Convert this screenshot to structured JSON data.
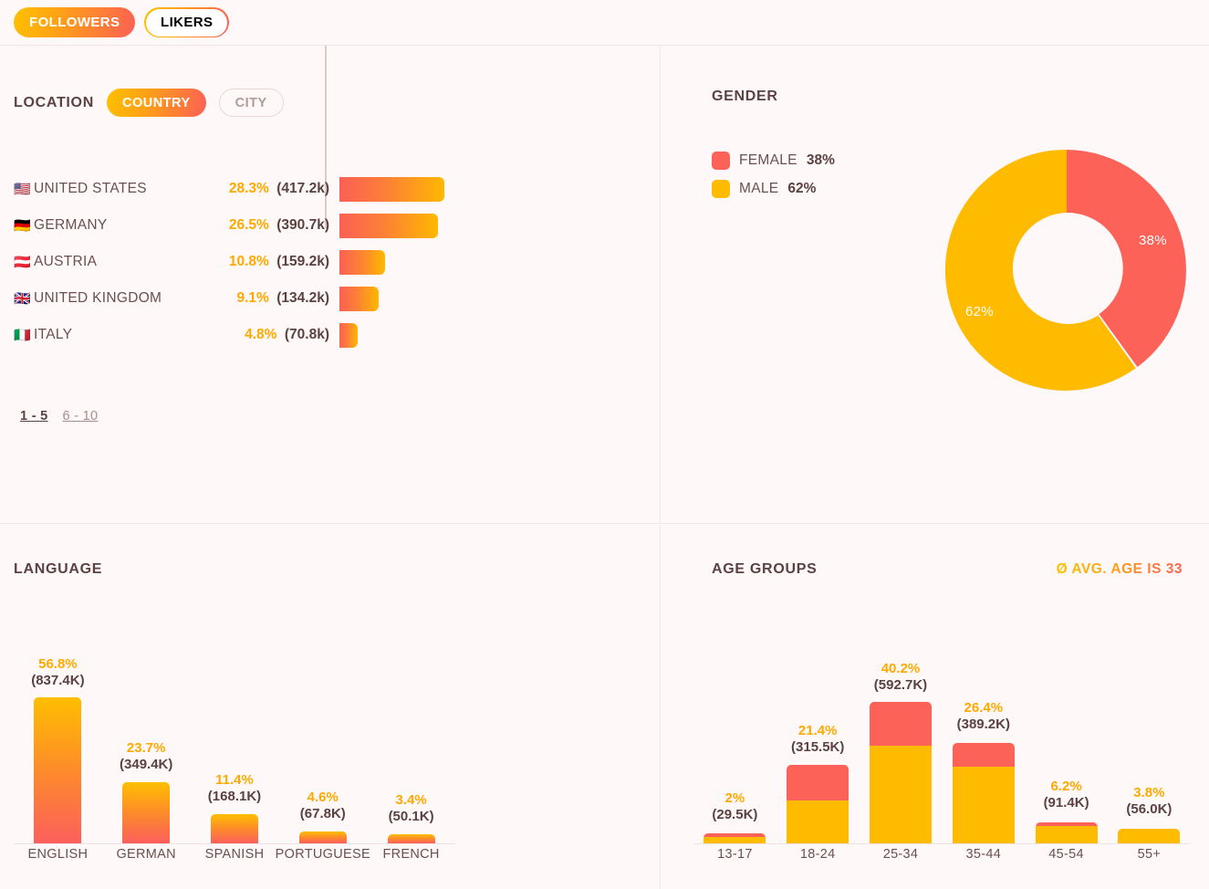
{
  "tabs": [
    {
      "label": "FOLLOWERS",
      "active": true
    },
    {
      "label": "LIKERS",
      "active": false
    }
  ],
  "location": {
    "title": "LOCATION",
    "toggles": [
      {
        "label": "COUNTRY",
        "active": true
      },
      {
        "label": "CITY",
        "active": false
      }
    ],
    "rows": [
      {
        "flag": "🇺🇸",
        "name": "UNITED STATES",
        "pct": "28.3%",
        "count": "(417.2k)",
        "value": 28.3
      },
      {
        "flag": "🇩🇪",
        "name": "GERMANY",
        "pct": "26.5%",
        "count": "(390.7k)",
        "value": 26.5
      },
      {
        "flag": "🇦🇹",
        "name": "AUSTRIA",
        "pct": "10.8%",
        "count": "(159.2k)",
        "value": 10.8
      },
      {
        "flag": "🇬🇧",
        "name": "UNITED KINGDOM",
        "pct": "9.1%",
        "count": "(134.2k)",
        "value": 9.1
      },
      {
        "flag": "🇮🇹",
        "name": "ITALY",
        "pct": "4.8%",
        "count": "(70.8k)",
        "value": 4.8
      }
    ],
    "pagination": [
      {
        "label": "1 - 5",
        "current": true
      },
      {
        "label": "6 - 10",
        "current": false
      }
    ]
  },
  "gender": {
    "title": "GENDER",
    "legend": [
      {
        "label": "FEMALE",
        "value": "38%",
        "color": "#FC6258"
      },
      {
        "label": "MALE",
        "value": "62%",
        "color": "#FFBB00"
      }
    ],
    "donut_labels": {
      "female": "38%",
      "male": "62%"
    }
  },
  "language": {
    "title": "LANGUAGE"
  },
  "age": {
    "title": "AGE GROUPS",
    "avg_age_text": "Ø AVG. AGE IS 33"
  },
  "colors": {
    "background": "#FEF9F8",
    "divider": "#F1E7E5",
    "accent_red": "#FB6054",
    "accent_orange": "#FFA017",
    "accent_yellow": "#FFC000",
    "female": "#FC6258",
    "male": "#FFBB00",
    "text_dark": "#5C4143",
    "text_muted": "#6B4F50",
    "pct_orange": "#FFA900"
  },
  "chart_data": [
    {
      "type": "bar",
      "name": "location-countries",
      "title": "LOCATION",
      "orientation": "horizontal",
      "categories": [
        "UNITED STATES",
        "GERMANY",
        "AUSTRIA",
        "UNITED KINGDOM",
        "ITALY"
      ],
      "values": [
        28.3,
        26.5,
        10.8,
        9.1,
        4.8
      ],
      "value_labels": [
        "28.3%",
        "26.5%",
        "10.8%",
        "9.1%",
        "4.8%"
      ],
      "counts": [
        "(417.2k)",
        "(390.7k)",
        "(159.2k)",
        "(134.2k)",
        "(70.8k)"
      ],
      "count_values": [
        417200,
        390700,
        159200,
        134200,
        70800
      ],
      "ylabel": "",
      "xlabel": "",
      "xlim": [
        0,
        28.3
      ],
      "grid": false,
      "legend": "none"
    },
    {
      "type": "pie",
      "name": "gender-donut",
      "title": "GENDER",
      "donut": true,
      "labels": [
        "FEMALE",
        "MALE"
      ],
      "values": [
        38,
        62
      ],
      "value_labels": [
        "38%",
        "62%"
      ],
      "colors": [
        "#FC6258",
        "#FFBB00"
      ],
      "start_angle_deg": 0,
      "direction": "clockwise",
      "legend": "top-left"
    },
    {
      "type": "bar",
      "name": "language-bars",
      "title": "LANGUAGE",
      "orientation": "vertical",
      "categories": [
        "ENGLISH",
        "GERMAN",
        "SPANISH",
        "PORTUGUESE",
        "FRENCH"
      ],
      "values": [
        56.8,
        23.7,
        11.4,
        4.6,
        3.4
      ],
      "value_labels": [
        "56.8%",
        "23.7%",
        "11.4%",
        "4.6%",
        "3.4%"
      ],
      "counts": [
        "(837.4K)",
        "(349.4K)",
        "(168.1K)",
        "(67.8K)",
        "(50.1K)"
      ],
      "count_values": [
        837400,
        349400,
        168100,
        67800,
        50100
      ],
      "ylim": [
        0,
        56.8
      ],
      "grid": false,
      "legend": "none"
    },
    {
      "type": "bar",
      "name": "age-groups-stacked",
      "title": "AGE GROUPS",
      "orientation": "vertical",
      "stacked": true,
      "categories": [
        "13-17",
        "18-24",
        "25-34",
        "35-44",
        "45-54",
        "55+"
      ],
      "values": [
        2.0,
        21.4,
        40.2,
        26.4,
        6.2,
        3.8
      ],
      "value_labels": [
        "2%",
        "21.4%",
        "40.2%",
        "26.4%",
        "6.2%",
        "3.8%"
      ],
      "counts": [
        "(29.5K)",
        "(315.5K)",
        "(592.7K)",
        "(389.2K)",
        "(91.4K)",
        "(56.0K)"
      ],
      "count_values": [
        29500,
        315500,
        592700,
        389200,
        91400,
        56000
      ],
      "series": [
        {
          "name": "MALE",
          "color": "#FFBB00",
          "values": [
            1.4,
            11.6,
            28.0,
            21.4,
            5.6,
            3.8
          ]
        },
        {
          "name": "FEMALE",
          "color": "#FC6258",
          "values": [
            0.6,
            9.8,
            12.2,
            5.0,
            0.6,
            0.0
          ]
        }
      ],
      "annotation": "Ø AVG. AGE IS 33",
      "avg_age": 33,
      "ylim": [
        0,
        40.2
      ],
      "grid": false,
      "legend": "none"
    }
  ]
}
